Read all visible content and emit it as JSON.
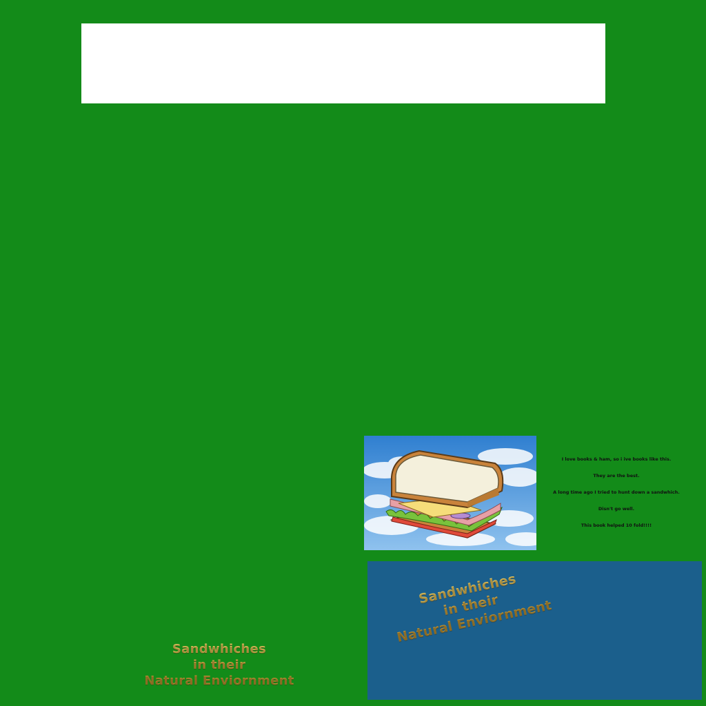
{
  "review": {
    "lines": [
      "I love books & ham, so i ive books like this.",
      "They are the best.",
      "A long time ago I tried to hunt down a sandwhich.",
      "Disn't go well.",
      "This book helped 10 fold!!!!"
    ]
  },
  "cover_title": {
    "line1": "Sandwhiches",
    "line2": "in their",
    "line3": "Natural Enviornment"
  },
  "colors": {
    "background": "#138b19",
    "header_box": "#ffffff",
    "blue_panel": "#1b5f8c",
    "title_gold": "#d9b04a"
  },
  "icons": {
    "photo": "sandwich-in-sky-image"
  }
}
